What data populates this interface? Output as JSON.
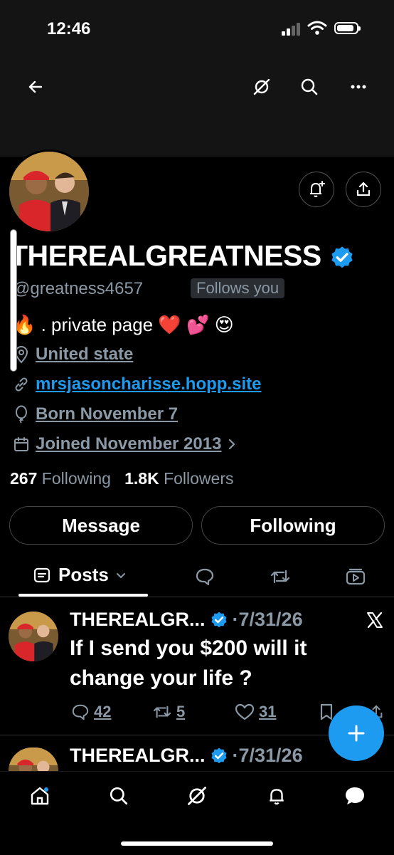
{
  "status_bar": {
    "time": "12:46",
    "battery_level": 0.9
  },
  "profile": {
    "display_name": "THEREALGREATNESS",
    "handle": "@greatness4657",
    "follows_you": "Follows you",
    "bio": "🔥 . private page ❤️ 💕 😍",
    "location": "United state",
    "website": "mrsjasoncharisse.hopp.site",
    "birthday": "Born November 7",
    "joined": "Joined November 2013",
    "following_count": "267",
    "following_label": "Following",
    "followers_count": "1.8K",
    "followers_label": "Followers"
  },
  "buttons": {
    "message": "Message",
    "following": "Following"
  },
  "tabs": {
    "posts": "Posts"
  },
  "posts": [
    {
      "author": "THEREALGR...",
      "date": "·7/31/26",
      "text": "If I send you $200 will it change your life ?",
      "replies": "42",
      "reposts": "5",
      "likes": "31"
    },
    {
      "author": "THEREALGR...",
      "date": "·7/31/26"
    }
  ],
  "colors": {
    "accent": "#1d9bf0",
    "background": "#000000",
    "muted": "#8b98a5"
  },
  "icons": [
    "back-arrow-icon",
    "grok-icon",
    "search-icon",
    "more-icon",
    "notification-bell-icon",
    "share-icon",
    "verified-icon",
    "location-icon",
    "link-icon",
    "balloon-icon",
    "calendar-icon",
    "posts-icon",
    "replies-icon",
    "repost-icon",
    "media-icon",
    "x-logo-icon",
    "reply-icon",
    "like-icon",
    "bookmark-icon",
    "home-icon",
    "compose-icon"
  ]
}
